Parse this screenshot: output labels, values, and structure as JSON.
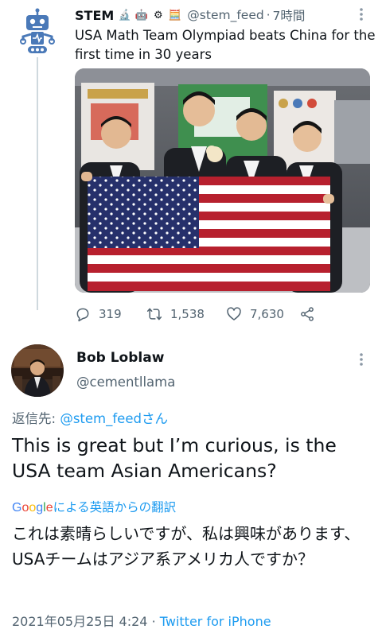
{
  "parent_tweet": {
    "name": "STEM",
    "emojis": [
      "🔬",
      "🤖",
      "⚙",
      "🧮"
    ],
    "handle": "@stem_feed",
    "separator": "·",
    "time": "7時間",
    "text": "USA Math Team Olympiad beats China for the first time in 30 years",
    "actions": {
      "replies": "319",
      "retweets": "1,538",
      "likes": "7,630"
    }
  },
  "tweet": {
    "name": "Bob Loblaw",
    "handle": "@cementllama",
    "reply_prefix": "返信先: ",
    "reply_handle": "@stem_feed",
    "reply_suffix": "さん",
    "text": "This is great but I’m curious, is the USA team Asian Americans?",
    "translate_brand": "Google",
    "translate_label": "による英語からの翻訳",
    "translated_text": "これは素晴らしいですが、私は興味があります、USAチームはアジア系アメリカ人ですか？",
    "date": "2021年05月25日 4:24",
    "separator": "·",
    "source": "Twitter for iPhone"
  },
  "icons": {
    "bot_avatar": "robot-icon",
    "more": "more-vertical-icon",
    "reply": "reply-icon",
    "retweet": "retweet-icon",
    "like": "heart-icon",
    "share": "share-icon"
  },
  "colors": {
    "link": "#1d9bf0",
    "muted": "#536471",
    "text": "#0f1419",
    "robot": "#4a79b8"
  }
}
